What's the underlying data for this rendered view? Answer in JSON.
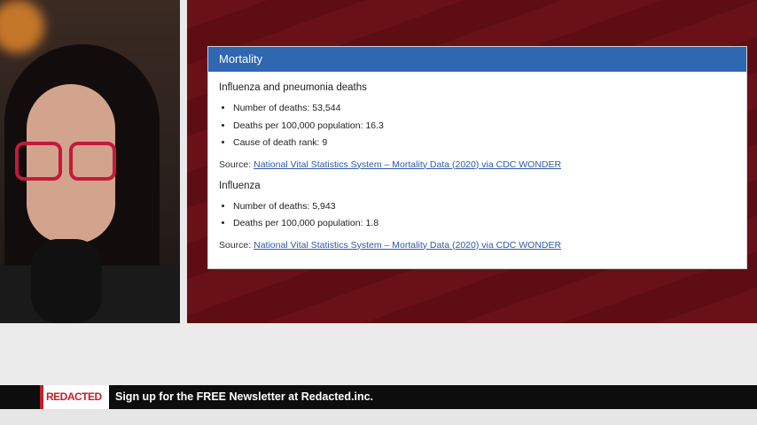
{
  "panel": {
    "header": "Mortality",
    "sections": [
      {
        "title": "Influenza and pneumonia deaths",
        "items": [
          "Number of deaths: 53,544",
          "Deaths per 100,000 population: 16.3",
          "Cause of death rank: 9"
        ],
        "source_label": "Source: ",
        "source_link": "National Vital Statistics System – Mortality Data (2020) via CDC WONDER"
      },
      {
        "title": "Influenza",
        "items": [
          "Number of deaths: 5,943",
          "Deaths per 100,000 population: 1.8"
        ],
        "source_label": "Source: ",
        "source_link": "National Vital Statistics System – Mortality Data (2020) via CDC WONDER"
      }
    ]
  },
  "lower_third": {
    "logo": "REDACTED",
    "ticker": "Sign up for the FREE Newsletter at Redacted.inc."
  },
  "colors": {
    "header_blue": "#2f67b1",
    "link_blue": "#2d5aa8",
    "brand_red": "#c41f2a",
    "background_red": "#5a0f14"
  }
}
